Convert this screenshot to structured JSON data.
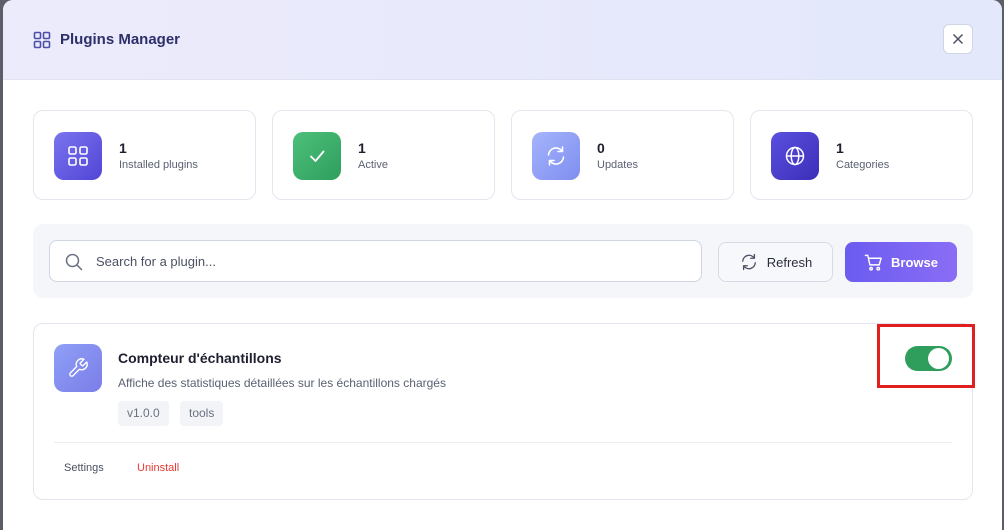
{
  "header": {
    "title": "Plugins Manager"
  },
  "stats": [
    {
      "value": "1",
      "label": "Installed plugins",
      "icon": "grid-icon"
    },
    {
      "value": "1",
      "label": "Active",
      "icon": "check-icon"
    },
    {
      "value": "0",
      "label": "Updates",
      "icon": "refresh-icon"
    },
    {
      "value": "1",
      "label": "Categories",
      "icon": "globe-icon"
    }
  ],
  "search": {
    "placeholder": "Search for a plugin...",
    "value": ""
  },
  "toolbar": {
    "refresh_label": "Refresh",
    "browse_label": "Browse"
  },
  "plugin": {
    "name": "Compteur d'échantillons",
    "description": "Affiche des statistiques détaillées sur les échantillons chargés",
    "tags": [
      "v1.0.0",
      "tools"
    ],
    "enabled": true,
    "settings_label": "Settings",
    "uninstall_label": "Uninstall"
  },
  "colors": {
    "accent": "#6b5cf0",
    "success": "#2f9e5d",
    "danger": "#e53935",
    "highlight": "#e02020"
  }
}
